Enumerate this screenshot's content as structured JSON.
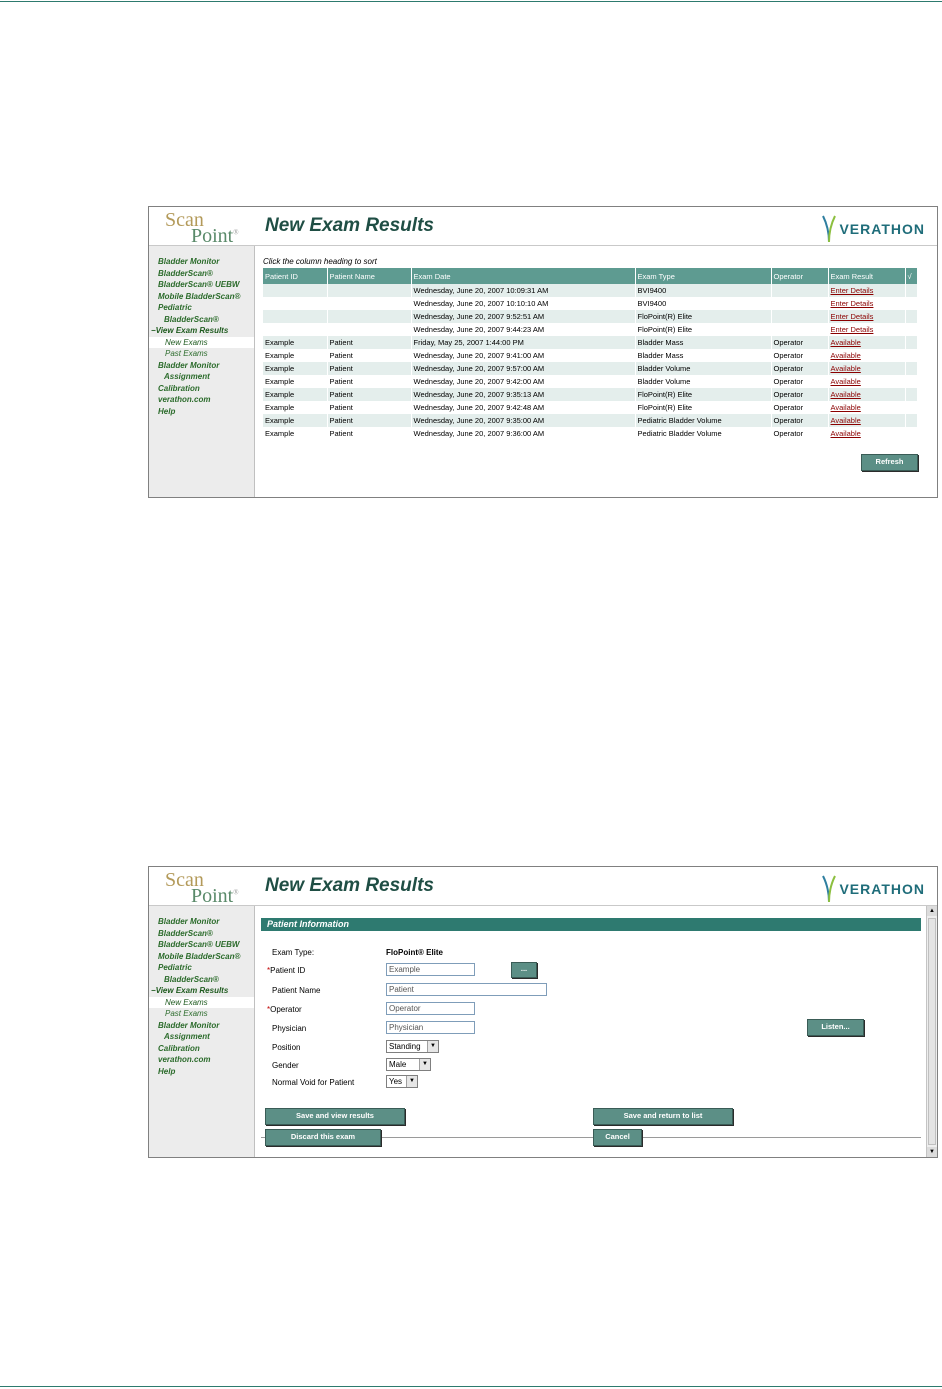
{
  "logo": {
    "scan": "Scan",
    "point": "Point",
    "mark": "®"
  },
  "vendor_logo": "VERATHON",
  "nav": {
    "items": [
      {
        "label": "Bladder Monitor",
        "cls": ""
      },
      {
        "label": "BladderScan®",
        "cls": ""
      },
      {
        "label": "BladderScan® UEBW",
        "cls": ""
      },
      {
        "label": "Mobile BladderScan®",
        "cls": ""
      },
      {
        "label": "Pediatric",
        "cls": ""
      },
      {
        "label": "BladderScan®",
        "cls": "indent2"
      },
      {
        "label": "−View Exam Results",
        "cls": "active-group"
      },
      {
        "label": "New Exams",
        "cls": "sub current"
      },
      {
        "label": "Past Exams",
        "cls": "sub"
      },
      {
        "label": "Bladder Monitor",
        "cls": ""
      },
      {
        "label": "Assignment",
        "cls": "indent2"
      },
      {
        "label": "Calibration",
        "cls": ""
      },
      {
        "label": "verathon.com",
        "cls": ""
      },
      {
        "label": "Help",
        "cls": ""
      }
    ]
  },
  "list_screen": {
    "title": "New Exam Results",
    "sort_hint": "Click the column heading to sort",
    "columns": [
      "Patient ID",
      "Patient Name",
      "Exam Date",
      "Exam Type",
      "Operator",
      "Exam Result",
      "√"
    ],
    "rows": [
      [
        "",
        "",
        "Wednesday, June 20, 2007 10:09:31 AM",
        "BVI9400",
        "",
        "Enter Details",
        ""
      ],
      [
        "",
        "",
        "Wednesday, June 20, 2007 10:10:10 AM",
        "BVI9400",
        "",
        "Enter Details",
        ""
      ],
      [
        "",
        "",
        "Wednesday, June 20, 2007 9:52:51 AM",
        "FloPoint(R) Elite",
        "",
        "Enter Details",
        ""
      ],
      [
        "",
        "",
        "Wednesday, June 20, 2007 9:44:23 AM",
        "FloPoint(R) Elite",
        "",
        "Enter Details",
        ""
      ],
      [
        "Example",
        "Patient",
        "Friday, May 25, 2007 1:44:00 PM",
        "Bladder Mass",
        "Operator",
        "Available",
        ""
      ],
      [
        "Example",
        "Patient",
        "Wednesday, June 20, 2007 9:41:00 AM",
        "Bladder Mass",
        "Operator",
        "Available",
        ""
      ],
      [
        "Example",
        "Patient",
        "Wednesday, June 20, 2007 9:57:00 AM",
        "Bladder Volume",
        "Operator",
        "Available",
        ""
      ],
      [
        "Example",
        "Patient",
        "Wednesday, June 20, 2007 9:42:00 AM",
        "Bladder Volume",
        "Operator",
        "Available",
        ""
      ],
      [
        "Example",
        "Patient",
        "Wednesday, June 20, 2007 9:35:13 AM",
        "FloPoint(R) Elite",
        "Operator",
        "Available",
        ""
      ],
      [
        "Example",
        "Patient",
        "Wednesday, June 20, 2007 9:42:48 AM",
        "FloPoint(R) Elite",
        "Operator",
        "Available",
        ""
      ],
      [
        "Example",
        "Patient",
        "Wednesday, June 20, 2007 9:35:00 AM",
        "Pediatric Bladder Volume",
        "Operator",
        "Available",
        ""
      ],
      [
        "Example",
        "Patient",
        "Wednesday, June 20, 2007 9:36:00 AM",
        "Pediatric Bladder Volume",
        "Operator",
        "Available",
        ""
      ]
    ],
    "refresh_label": "Refresh"
  },
  "form_screen": {
    "title": "New Exam Results",
    "section": "Patient Information",
    "exam_type_label": "Exam Type:",
    "exam_type_value": "FloPoint® Elite",
    "required_mark": "*",
    "patient_id_label": "Patient ID",
    "patient_id_value": "Example",
    "lookup_label": "...",
    "patient_name_label": "Patient Name",
    "patient_name_value": "Patient",
    "operator_label": "Operator",
    "operator_value": "Operator",
    "physician_label": "Physician",
    "physician_value": "Physician",
    "position_label": "Position",
    "position_value": "Standing",
    "gender_label": "Gender",
    "gender_value": "Male",
    "normal_void_label": "Normal Void for Patient",
    "normal_void_value": "Yes",
    "listen_label": "Listen...",
    "save_view_label": "Save and view results",
    "save_return_label": "Save and return to list",
    "discard_label": "Discard this exam",
    "cancel_label": "Cancel"
  }
}
